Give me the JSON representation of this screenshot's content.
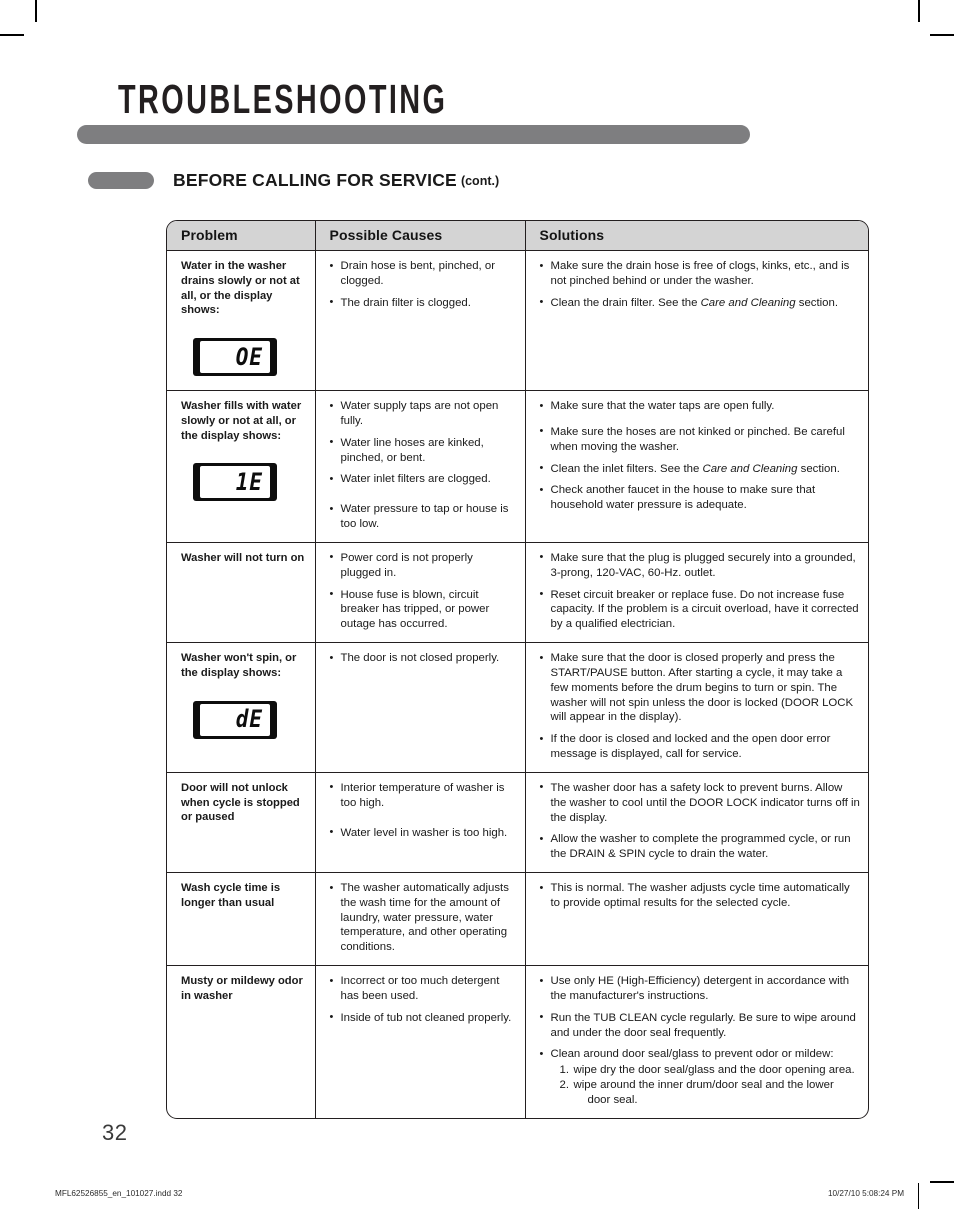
{
  "page": {
    "chapter_title": "TROUBLESHOOTING",
    "section_title": "BEFORE CALLING FOR SERVICE",
    "section_cont": "(cont.)",
    "page_number": "32",
    "slug_left": "MFL62526855_en_101027.indd   32",
    "slug_right": "10/27/10   5:08:24 PM",
    "accent_gray": "#7e7e80",
    "header_fill": "#d4d4d4",
    "border_color": "#231f20"
  },
  "table": {
    "columns": [
      {
        "label": "Problem"
      },
      {
        "label": "Possible Causes"
      },
      {
        "label": "Solutions"
      }
    ],
    "rows": [
      {
        "problem": "Water in the washer drains slowly or not at all, or the display shows:",
        "display_code": "OE",
        "causes": [
          "Drain hose is bent, pinched, or clogged.",
          "The drain filter is clogged."
        ],
        "solutions": [
          "Make sure the drain hose is free of clogs, kinks, etc., and is not pinched behind or under the washer.",
          "Clean the drain filter. See the Care and Cleaning section."
        ]
      },
      {
        "problem": "Washer fills with water slowly or not at all, or the display shows:",
        "display_code": "1E",
        "causes": [
          "Water supply taps are not open fully.",
          "Water line hoses are kinked, pinched, or bent.",
          "Water inlet filters are clogged.",
          "Water pressure to tap or house is too low."
        ],
        "solutions": [
          "Make sure that the water taps are open fully.",
          "Make sure the hoses are not kinked or pinched. Be careful when moving the washer.",
          "Clean the inlet filters. See the Care and Cleaning section.",
          "Check another faucet in the house to make sure that household water pressure is adequate."
        ]
      },
      {
        "problem": "Washer will not turn on",
        "display_code": "",
        "causes": [
          "Power cord is not properly plugged in.",
          "House fuse is blown, circuit breaker has tripped, or power outage has occurred."
        ],
        "solutions": [
          "Make sure that the plug is plugged securely into a grounded, 3-prong, 120-VAC, 60-Hz. outlet.",
          "Reset circuit breaker or replace fuse. Do not increase fuse capacity. If the problem is a circuit overload, have it corrected by a qualified electrician."
        ]
      },
      {
        "problem": "Washer won't spin, or the display shows:",
        "display_code": "dE",
        "causes": [
          "The door is not closed properly."
        ],
        "solutions": [
          "Make sure that the door is closed properly and press the START/PAUSE button. After starting a cycle, it may take a few moments before the drum begins to turn or spin. The washer will not spin unless the door is locked (DOOR LOCK will appear in the display).",
          "If the door is closed and locked and the open door error message is displayed, call for service."
        ]
      },
      {
        "problem": "Door will not unlock when cycle is stopped or paused",
        "display_code": "",
        "causes": [
          "Interior temperature of washer is too high.",
          "Water level in washer is too high."
        ],
        "solutions": [
          "The washer door has a safety lock to prevent burns. Allow the washer to cool until the DOOR LOCK indicator turns off in the display.",
          "Allow the washer to complete the programmed cycle, or run the DRAIN & SPIN cycle to drain the water."
        ]
      },
      {
        "problem": "Wash cycle time is longer than usual",
        "display_code": "",
        "causes": [
          "The washer automatically adjusts the wash time for the amount of laundry, water pressure, water temperature, and other operating conditions."
        ],
        "solutions": [
          "This is normal. The washer adjusts cycle time automatically to provide optimal results for the selected cycle."
        ]
      },
      {
        "problem": "Musty or mildewy odor in washer",
        "display_code": "",
        "causes": [
          "Incorrect or too much detergent has been used.",
          "Inside of tub not cleaned properly."
        ],
        "solutions": [
          "Use only HE (High-Efficiency) detergent in accordance with the manufacturer's instructions.",
          "Run the TUB CLEAN cycle regularly. Be sure to wipe around and under the door seal frequently.",
          "Clean around door seal/glass to prevent odor or mildew:"
        ],
        "numbered_steps": [
          {
            "num": "1.",
            "text": "wipe dry the door seal/glass and the door opening area."
          },
          {
            "num": "2.",
            "text": "wipe around the inner drum/door seal and the lower door seal."
          }
        ]
      }
    ]
  }
}
